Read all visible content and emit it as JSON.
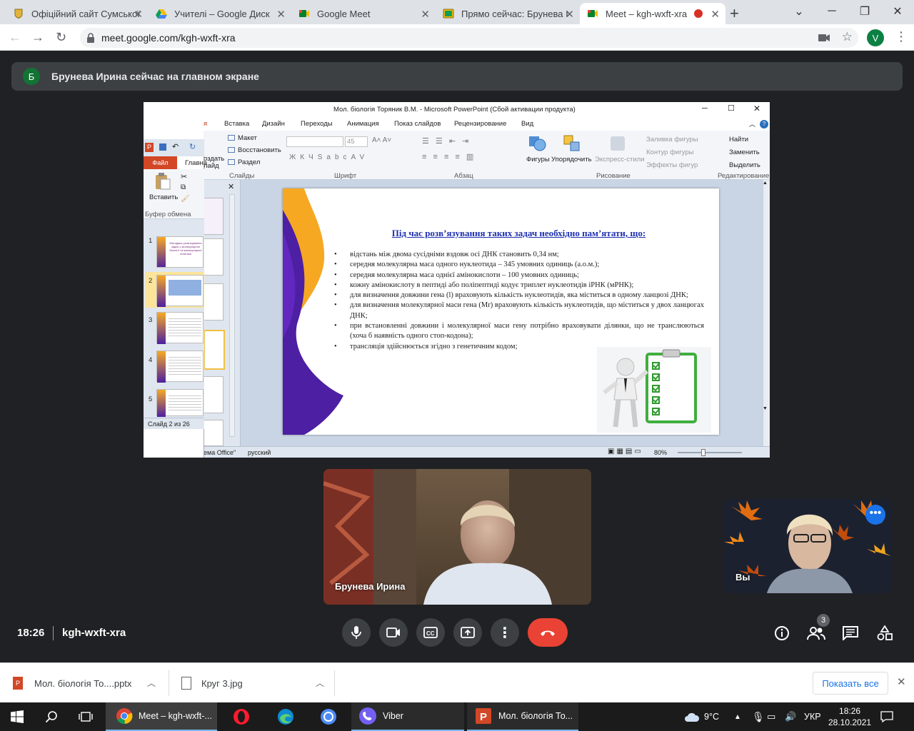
{
  "browser": {
    "tabs": [
      {
        "title": "Офіційний сайт Сумської"
      },
      {
        "title": "Учителі – Google Диск"
      },
      {
        "title": "Google Meet"
      },
      {
        "title": "Прямо сейчас: Брунева І"
      },
      {
        "title": "Meet – kgh-wxft-xra"
      }
    ],
    "url": "meet.google.com/kgh-wxft-xra",
    "profile_initial": "V"
  },
  "meet": {
    "banner_initial": "Б",
    "banner_text": "Брунева Ирина сейчас на главном экране",
    "time": "18:26",
    "meeting_code": "kgh-wxft-xra",
    "participant_main": "Брунева Ирина",
    "participant_self": "Вы",
    "people_count": "3"
  },
  "ppt": {
    "window_title": "Мол. біологія Торяник В.М.  -  Microsoft PowerPoint (Сбой активации продукта)",
    "tabs": [
      "я",
      "Вставка",
      "Дизайн",
      "Переходы",
      "Анимация",
      "Показ слайдов",
      "Рецензирование",
      "Вид"
    ],
    "file_tab": "Файл",
    "home_tab": "Главна",
    "paste": "Вставить",
    "clipboard": "Буфер обмена",
    "create_slide_1": "оздать",
    "create_slide_2": "лайд",
    "layout": "Макет",
    "reset": "Восстановить",
    "section": "Раздел",
    "group_slides": "Слайды",
    "group_font": "Шрифт",
    "group_paragraph": "Абзац",
    "group_drawing": "Рисование",
    "group_editing": "Редактирование",
    "font_size": "45",
    "shapes": "Фигуры",
    "arrange": "Упорядочить",
    "quick_styles": "Экспресс-стили",
    "fill": "Заливка фигуры",
    "outline": "Контур фигуры",
    "effects": "Эффекты фигур",
    "find": "Найти",
    "replace": "Заменить",
    "select": "Выделить",
    "slide_counter": "Слайд 2 из 26",
    "status_theme": "ема Office\"",
    "status_lang": "русский",
    "zoom": "80%",
    "thumbs": [
      "1",
      "2",
      "3",
      "4",
      "5"
    ],
    "thumb1_text": "Методика розв'язування задач з молекулярної біології та молекулярної генетики"
  },
  "slide": {
    "title": "Під час розв’язування таких задач необхідно пам’ятати, що:",
    "bullets": [
      "відстань між двома сусідніми вздовж осі ДНК становить 0,34 нм;",
      "середня молекулярна маса одного нуклеотида – 345 умовних одиниць  (а.о.м.);",
      "середня молекулярна маса однієї амінокислоти – 100 умовних одиниць;",
      "кожну амінокислоту в пептиді або поліпептиді  кодує триплет нуклеотидів  іРНК (мРНК);",
      "для визначення довжини гена (l) враховують кількість нуклеотидів, яка міститься в одному ланцюзі ДНК;",
      "для визначення молекулярної маси гена (Mr) враховують кількість нуклеотидів, що міститься у двох ланцюгах ДНК;",
      "при встановленні довжини і молекулярної маси гену потрібно враховувати ділянки, що не транслюються (хоча б наявність одного стоп-кодона);",
      "трансляція здійснюється згідно з генетичним кодом;"
    ]
  },
  "downloads": {
    "items": [
      {
        "name": "Мол. біологія То....pptx"
      },
      {
        "name": "Круг 3.jpg"
      }
    ],
    "show_all": "Показать все"
  },
  "taskbar": {
    "items": [
      {
        "label": "Meet – kgh-wxft-..."
      },
      {
        "label": "Viber"
      },
      {
        "label": "Мол. біологія То..."
      }
    ],
    "weather": "9°C",
    "lang": "УКР",
    "clock_time": "18:26",
    "clock_date": "28.10.2021"
  }
}
